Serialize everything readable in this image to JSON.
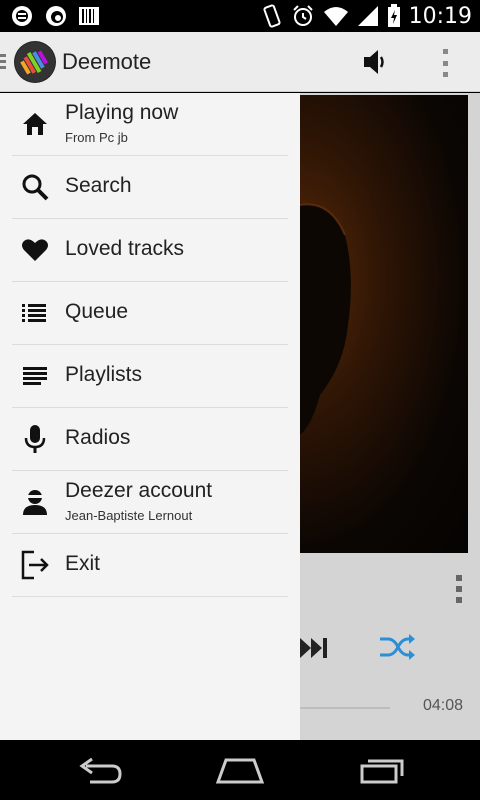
{
  "status_bar": {
    "time": "10:19",
    "icons": [
      "app-notification-icon",
      "sync-icon",
      "barcode-icon",
      "vibrate-icon",
      "alarm-icon",
      "wifi-icon",
      "signal-icon",
      "battery-icon"
    ]
  },
  "action_bar": {
    "title": "Deemote",
    "icons": [
      "app-logo-icon",
      "volume-icon",
      "overflow-menu-icon"
    ]
  },
  "drawer": {
    "items": [
      {
        "label": "Playing now",
        "subtitle": "From Pc jb",
        "icon": "home-icon"
      },
      {
        "label": "Search",
        "icon": "search-icon"
      },
      {
        "label": "Loved tracks",
        "icon": "heart-icon"
      },
      {
        "label": "Queue",
        "icon": "queue-icon"
      },
      {
        "label": "Playlists",
        "icon": "playlists-icon"
      },
      {
        "label": "Radios",
        "icon": "microphone-icon"
      },
      {
        "label": "Deezer account",
        "subtitle": "Jean-Baptiste Lernout",
        "icon": "account-icon"
      },
      {
        "label": "Exit",
        "icon": "exit-icon"
      }
    ]
  },
  "player": {
    "duration": "04:08",
    "accent_color": "#2a8fd6"
  },
  "nav_bar": {
    "icons": [
      "back-icon",
      "home-nav-icon",
      "recents-icon"
    ]
  }
}
